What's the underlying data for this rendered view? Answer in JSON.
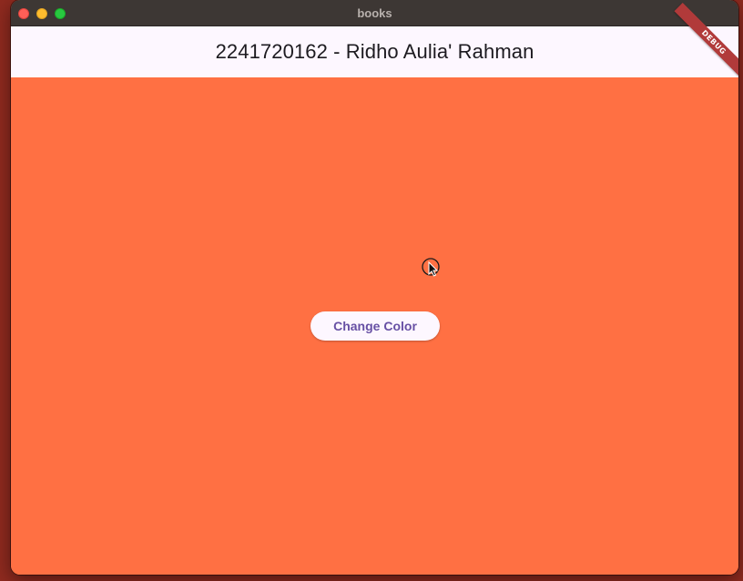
{
  "window": {
    "title": "books"
  },
  "appbar": {
    "title": "2241720162 - Ridho Aulia' Rahman"
  },
  "debug_banner": {
    "label": "DEBUG"
  },
  "main": {
    "button_label": "Change Color",
    "background_color": "#ff7043"
  },
  "colors": {
    "appbar_bg": "#fdf7ff",
    "button_text": "#6750a4",
    "titlebar_bg": "#3d3734"
  },
  "icons": {
    "cursor": "mouse-pointer-icon"
  }
}
